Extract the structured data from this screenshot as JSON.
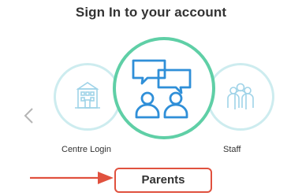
{
  "header": {
    "title": "Sign In to your account"
  },
  "carousel": {
    "options": [
      {
        "label": "Centre Login",
        "icon": "building-icon"
      },
      {
        "label": "",
        "icon": "chat-people-icon"
      },
      {
        "label": "Staff",
        "icon": "group-icon"
      }
    ],
    "selected_label": "Parents"
  },
  "colors": {
    "accent_green": "#5fcfa6",
    "icon_blue": "#2f8fd8",
    "inactive_ring": "#cdecef",
    "annotation_red": "#e0513e"
  }
}
